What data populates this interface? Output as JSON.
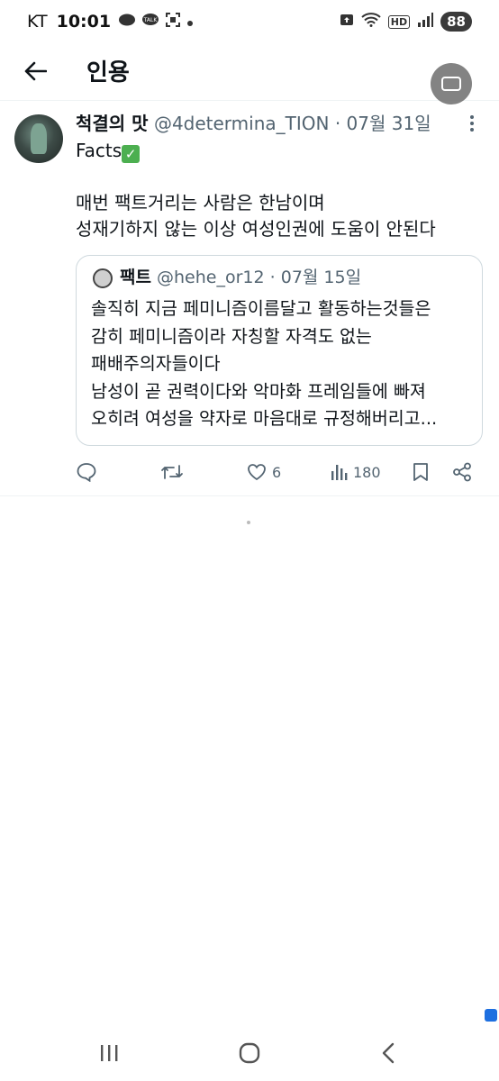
{
  "status_bar": {
    "carrier": "KT",
    "time": "10:01",
    "battery": "88",
    "hd_label": "HD"
  },
  "header": {
    "title": "인용"
  },
  "tweet": {
    "author_name": "척결의 맛",
    "handle": "@4determina_TION",
    "separator": "·",
    "date": "07월 31일",
    "first_line": "Facts",
    "body": "매번 팩트거리는 사람은 한남이며\n성재기하지 않는 이상 여성인권에 도움이 안된다",
    "quote": {
      "author_name": "팩트",
      "handle": "@hehe_or12",
      "separator": "·",
      "date": "07월 15일",
      "body": "솔직히 지금 페미니즘이름달고 활동하는것들은\n감히 페미니즘이라 자칭할 자격도 없는\n패배주의자들이다\n남성이 곧 권력이다와 악마화 프레임들에 빠져\n오히려 여성을 약자로 마음대로 규정해버리고..."
    },
    "stats": {
      "likes": "6",
      "views": "180"
    }
  },
  "colors": {
    "text_primary": "#0f1419",
    "text_secondary": "#536471",
    "border": "#cfd9de",
    "checkmark": "#4caf50"
  }
}
